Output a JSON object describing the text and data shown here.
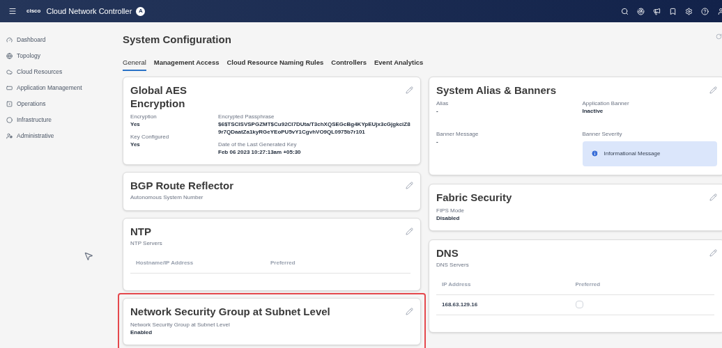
{
  "header": {
    "logo_text": "cisco",
    "title": "Cloud Network Controller",
    "badge": "A"
  },
  "sidebar": {
    "items": [
      {
        "label": "Dashboard",
        "selected": false
      },
      {
        "label": "Topology",
        "selected": false
      },
      {
        "label": "Cloud Resources",
        "selected": false
      },
      {
        "label": "Application Management",
        "selected": false
      },
      {
        "label": "Operations",
        "selected": false
      },
      {
        "label": "Infrastructure",
        "selected": false
      },
      {
        "label": "Administrative",
        "selected": false
      }
    ]
  },
  "page": {
    "title": "System Configuration"
  },
  "tabs": [
    {
      "label": "General",
      "selected": true
    },
    {
      "label": "Management Access",
      "selected": false
    },
    {
      "label": "Cloud Resource Naming Rules",
      "selected": false
    },
    {
      "label": "Controllers",
      "selected": false
    },
    {
      "label": "Event Analytics",
      "selected": false
    }
  ],
  "left_cards": [
    {
      "title": "Global AES Encryption",
      "highlighted": false,
      "columns": [
        [
          {
            "kind": "field",
            "label": "Encryption",
            "value": "Yes"
          },
          {
            "kind": "field",
            "label": "Key Configured",
            "value": "Yes"
          }
        ],
        [
          {
            "kind": "field",
            "label": "Encrypted Passphrase",
            "value": "$6$TSCISVSPGZMT$Cu92CI7DUta/T3chXQSEGcBg4KYpEUjx3cGjgkciZ89r7QDaatZa1kyRGeYEoPU5vY1CgvhVO9QL0975b7r101"
          },
          {
            "kind": "field",
            "label": "Date of the Last Generated Key",
            "value": "Feb 06 2023 10:27:13am +05:30"
          }
        ]
      ]
    },
    {
      "title": "BGP Route Reflector",
      "highlighted": false,
      "subtitle": "Autonomous System Number"
    },
    {
      "title": "NTP",
      "highlighted": false,
      "subtitle": "NTP Servers",
      "table": {
        "columns": [
          "Hostname/IP Address",
          "Preferred"
        ]
      }
    },
    {
      "title": "Network Security Group at Subnet Level",
      "highlighted": true,
      "columns": [
        [
          {
            "kind": "field",
            "label": "Network Security Group at Subnet Level",
            "value": "Enabled"
          }
        ]
      ]
    }
  ],
  "right_cards": [
    {
      "title": "System Alias & Banners",
      "highlighted": false,
      "columns": [
        [
          {
            "kind": "field",
            "label": "Alias",
            "value": "-"
          },
          {
            "kind": "field",
            "label": "Banner Message",
            "value": "-"
          }
        ],
        [
          {
            "kind": "field",
            "label": "Application Banner",
            "value": "Inactive"
          },
          {
            "kind": "alert",
            "label": "Banner Severity",
            "value": "Informational Message"
          }
        ]
      ]
    },
    {
      "title": "Fabric Security",
      "highlighted": false,
      "columns": [
        [
          {
            "kind": "field",
            "label": "FIPS Mode",
            "value": "Disabled"
          }
        ]
      ]
    },
    {
      "title": "DNS",
      "highlighted": false,
      "subtitle": "DNS Servers",
      "table": {
        "columns": [
          "IP Address",
          "Preferred"
        ],
        "rows": [
          {
            "address": "168.63.129.16",
            "preferred": false
          }
        ]
      }
    }
  ]
}
